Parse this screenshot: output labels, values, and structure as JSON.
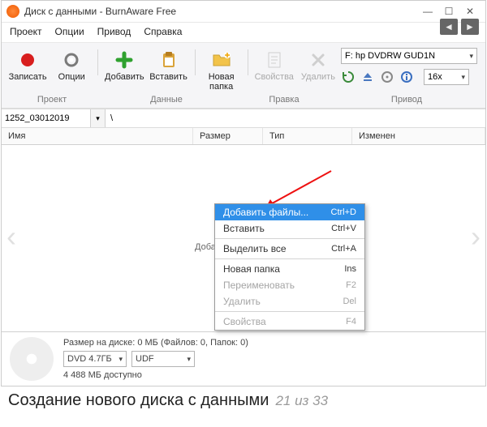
{
  "titlebar": {
    "title": "Диск с данными - BurnAware Free"
  },
  "menubar": [
    "Проект",
    "Опции",
    "Привод",
    "Справка"
  ],
  "toolbar": {
    "record": "Записать",
    "options": "Опции",
    "add": "Добавить",
    "paste": "Вставить",
    "newfolder_l1": "Новая",
    "newfolder_l2": "папка",
    "props": "Свойства",
    "delete": "Удалить"
  },
  "groups": {
    "project": "Проект",
    "data": "Данные",
    "edit": "Правка",
    "drive": "Привод"
  },
  "drive_combo": "F: hp DVDRW GUD1N",
  "speed_combo": "16x",
  "project_name": "1252_03012019",
  "path": "\\",
  "columns": {
    "name": "Имя",
    "size": "Размер",
    "type": "Тип",
    "modified": "Изменен"
  },
  "hint_prefix": "Добав",
  "context": {
    "add_files": "Добавить файлы...",
    "paste": "Вставить",
    "select_all": "Выделить все",
    "new_folder": "Новая папка",
    "rename": "Переименовать",
    "delete": "Удалить",
    "props": "Свойства",
    "k_add": "Ctrl+D",
    "k_paste": "Ctrl+V",
    "k_selall": "Ctrl+A",
    "k_newf": "Ins",
    "k_ren": "F2",
    "k_del": "Del",
    "k_props": "F4"
  },
  "footer": {
    "sizeline": "Размер на диске: 0 МБ (Файлов: 0, Папок: 0)",
    "media": "DVD 4.7ГБ",
    "fs": "UDF",
    "avail": "4 488 МБ доступно"
  },
  "caption": {
    "text": "Создание нового диска с данными",
    "count": "21 из 33"
  }
}
